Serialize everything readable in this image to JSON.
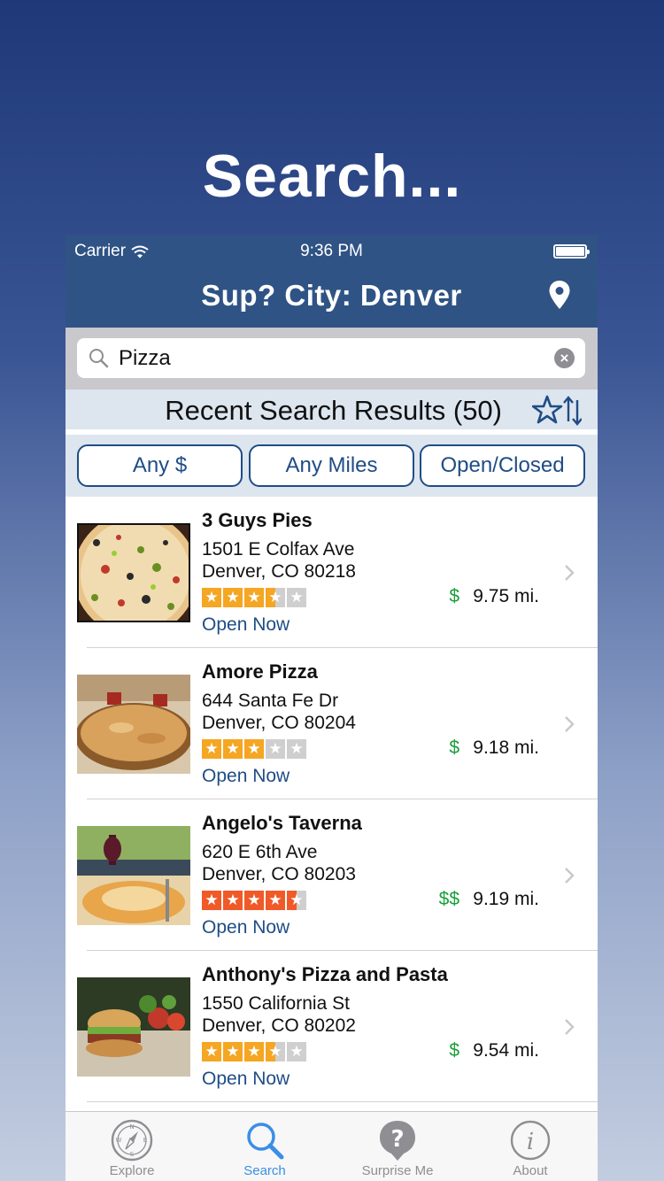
{
  "promo": {
    "title": "Search..."
  },
  "status_bar": {
    "carrier": "Carrier",
    "time": "9:36 PM"
  },
  "nav": {
    "title": "Sup? City:  Denver",
    "location_icon": "location-pin-icon"
  },
  "search": {
    "value": "Pizza",
    "icon": "search-icon",
    "clear_icon": "clear-icon"
  },
  "results": {
    "title": "Recent Search Results (50)",
    "sort_icon": "star-sort-icon"
  },
  "filters": [
    {
      "label": "Any $"
    },
    {
      "label": "Any Miles"
    },
    {
      "label": "Open/Closed"
    }
  ],
  "colors": {
    "nav": "#2f5385",
    "accent": "#1f4d85",
    "price": "#19a03a",
    "star_orange": "#f5a623",
    "star_red": "#f05a28",
    "star_empty": "#cfcfcf",
    "tab_active": "#3a8ee6"
  },
  "restaurants": [
    {
      "name": "3 Guys Pies",
      "address1": "1501 E Colfax Ave",
      "address2": "Denver, CO 80218",
      "rating": 3.5,
      "star_color": "orange",
      "status": "Open Now",
      "price": "$",
      "distance": "9.75 mi."
    },
    {
      "name": "Amore Pizza",
      "address1": "644 Santa Fe Dr",
      "address2": "Denver, CO 80204",
      "rating": 3,
      "star_color": "orange",
      "status": "Open Now",
      "price": "$",
      "distance": "9.18 mi."
    },
    {
      "name": "Angelo's Taverna",
      "address1": "620 E 6th Ave",
      "address2": "Denver, CO 80203",
      "rating": 4.5,
      "star_color": "red",
      "status": "Open Now",
      "price": "$$",
      "distance": "9.19 mi."
    },
    {
      "name": "Anthony's Pizza and Pasta",
      "address1": "1550 California St",
      "address2": "Denver, CO 80202",
      "rating": 3.5,
      "star_color": "orange",
      "status": "Open Now",
      "price": "$",
      "distance": "9.54 mi."
    }
  ],
  "tabs": [
    {
      "label": "Explore",
      "icon": "compass-icon",
      "active": false
    },
    {
      "label": "Search",
      "icon": "search-icon",
      "active": true
    },
    {
      "label": "Surprise Me",
      "icon": "question-bubble-icon",
      "active": false
    },
    {
      "label": "About",
      "icon": "info-icon",
      "active": false
    }
  ]
}
